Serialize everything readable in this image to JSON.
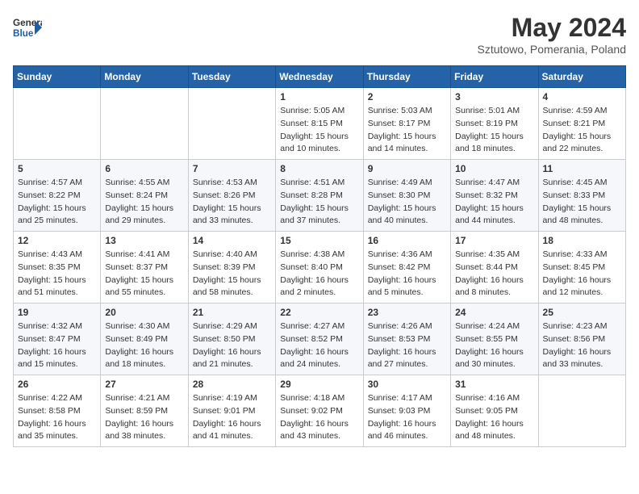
{
  "header": {
    "logo_general": "General",
    "logo_blue": "Blue",
    "month_year": "May 2024",
    "location": "Sztutowo, Pomerania, Poland"
  },
  "weekdays": [
    "Sunday",
    "Monday",
    "Tuesday",
    "Wednesday",
    "Thursday",
    "Friday",
    "Saturday"
  ],
  "weeks": [
    [
      {
        "day": "",
        "sunrise": "",
        "sunset": "",
        "daylight": ""
      },
      {
        "day": "",
        "sunrise": "",
        "sunset": "",
        "daylight": ""
      },
      {
        "day": "",
        "sunrise": "",
        "sunset": "",
        "daylight": ""
      },
      {
        "day": "1",
        "sunrise": "Sunrise: 5:05 AM",
        "sunset": "Sunset: 8:15 PM",
        "daylight": "Daylight: 15 hours and 10 minutes."
      },
      {
        "day": "2",
        "sunrise": "Sunrise: 5:03 AM",
        "sunset": "Sunset: 8:17 PM",
        "daylight": "Daylight: 15 hours and 14 minutes."
      },
      {
        "day": "3",
        "sunrise": "Sunrise: 5:01 AM",
        "sunset": "Sunset: 8:19 PM",
        "daylight": "Daylight: 15 hours and 18 minutes."
      },
      {
        "day": "4",
        "sunrise": "Sunrise: 4:59 AM",
        "sunset": "Sunset: 8:21 PM",
        "daylight": "Daylight: 15 hours and 22 minutes."
      }
    ],
    [
      {
        "day": "5",
        "sunrise": "Sunrise: 4:57 AM",
        "sunset": "Sunset: 8:22 PM",
        "daylight": "Daylight: 15 hours and 25 minutes."
      },
      {
        "day": "6",
        "sunrise": "Sunrise: 4:55 AM",
        "sunset": "Sunset: 8:24 PM",
        "daylight": "Daylight: 15 hours and 29 minutes."
      },
      {
        "day": "7",
        "sunrise": "Sunrise: 4:53 AM",
        "sunset": "Sunset: 8:26 PM",
        "daylight": "Daylight: 15 hours and 33 minutes."
      },
      {
        "day": "8",
        "sunrise": "Sunrise: 4:51 AM",
        "sunset": "Sunset: 8:28 PM",
        "daylight": "Daylight: 15 hours and 37 minutes."
      },
      {
        "day": "9",
        "sunrise": "Sunrise: 4:49 AM",
        "sunset": "Sunset: 8:30 PM",
        "daylight": "Daylight: 15 hours and 40 minutes."
      },
      {
        "day": "10",
        "sunrise": "Sunrise: 4:47 AM",
        "sunset": "Sunset: 8:32 PM",
        "daylight": "Daylight: 15 hours and 44 minutes."
      },
      {
        "day": "11",
        "sunrise": "Sunrise: 4:45 AM",
        "sunset": "Sunset: 8:33 PM",
        "daylight": "Daylight: 15 hours and 48 minutes."
      }
    ],
    [
      {
        "day": "12",
        "sunrise": "Sunrise: 4:43 AM",
        "sunset": "Sunset: 8:35 PM",
        "daylight": "Daylight: 15 hours and 51 minutes."
      },
      {
        "day": "13",
        "sunrise": "Sunrise: 4:41 AM",
        "sunset": "Sunset: 8:37 PM",
        "daylight": "Daylight: 15 hours and 55 minutes."
      },
      {
        "day": "14",
        "sunrise": "Sunrise: 4:40 AM",
        "sunset": "Sunset: 8:39 PM",
        "daylight": "Daylight: 15 hours and 58 minutes."
      },
      {
        "day": "15",
        "sunrise": "Sunrise: 4:38 AM",
        "sunset": "Sunset: 8:40 PM",
        "daylight": "Daylight: 16 hours and 2 minutes."
      },
      {
        "day": "16",
        "sunrise": "Sunrise: 4:36 AM",
        "sunset": "Sunset: 8:42 PM",
        "daylight": "Daylight: 16 hours and 5 minutes."
      },
      {
        "day": "17",
        "sunrise": "Sunrise: 4:35 AM",
        "sunset": "Sunset: 8:44 PM",
        "daylight": "Daylight: 16 hours and 8 minutes."
      },
      {
        "day": "18",
        "sunrise": "Sunrise: 4:33 AM",
        "sunset": "Sunset: 8:45 PM",
        "daylight": "Daylight: 16 hours and 12 minutes."
      }
    ],
    [
      {
        "day": "19",
        "sunrise": "Sunrise: 4:32 AM",
        "sunset": "Sunset: 8:47 PM",
        "daylight": "Daylight: 16 hours and 15 minutes."
      },
      {
        "day": "20",
        "sunrise": "Sunrise: 4:30 AM",
        "sunset": "Sunset: 8:49 PM",
        "daylight": "Daylight: 16 hours and 18 minutes."
      },
      {
        "day": "21",
        "sunrise": "Sunrise: 4:29 AM",
        "sunset": "Sunset: 8:50 PM",
        "daylight": "Daylight: 16 hours and 21 minutes."
      },
      {
        "day": "22",
        "sunrise": "Sunrise: 4:27 AM",
        "sunset": "Sunset: 8:52 PM",
        "daylight": "Daylight: 16 hours and 24 minutes."
      },
      {
        "day": "23",
        "sunrise": "Sunrise: 4:26 AM",
        "sunset": "Sunset: 8:53 PM",
        "daylight": "Daylight: 16 hours and 27 minutes."
      },
      {
        "day": "24",
        "sunrise": "Sunrise: 4:24 AM",
        "sunset": "Sunset: 8:55 PM",
        "daylight": "Daylight: 16 hours and 30 minutes."
      },
      {
        "day": "25",
        "sunrise": "Sunrise: 4:23 AM",
        "sunset": "Sunset: 8:56 PM",
        "daylight": "Daylight: 16 hours and 33 minutes."
      }
    ],
    [
      {
        "day": "26",
        "sunrise": "Sunrise: 4:22 AM",
        "sunset": "Sunset: 8:58 PM",
        "daylight": "Daylight: 16 hours and 35 minutes."
      },
      {
        "day": "27",
        "sunrise": "Sunrise: 4:21 AM",
        "sunset": "Sunset: 8:59 PM",
        "daylight": "Daylight: 16 hours and 38 minutes."
      },
      {
        "day": "28",
        "sunrise": "Sunrise: 4:19 AM",
        "sunset": "Sunset: 9:01 PM",
        "daylight": "Daylight: 16 hours and 41 minutes."
      },
      {
        "day": "29",
        "sunrise": "Sunrise: 4:18 AM",
        "sunset": "Sunset: 9:02 PM",
        "daylight": "Daylight: 16 hours and 43 minutes."
      },
      {
        "day": "30",
        "sunrise": "Sunrise: 4:17 AM",
        "sunset": "Sunset: 9:03 PM",
        "daylight": "Daylight: 16 hours and 46 minutes."
      },
      {
        "day": "31",
        "sunrise": "Sunrise: 4:16 AM",
        "sunset": "Sunset: 9:05 PM",
        "daylight": "Daylight: 16 hours and 48 minutes."
      },
      {
        "day": "",
        "sunrise": "",
        "sunset": "",
        "daylight": ""
      }
    ]
  ]
}
